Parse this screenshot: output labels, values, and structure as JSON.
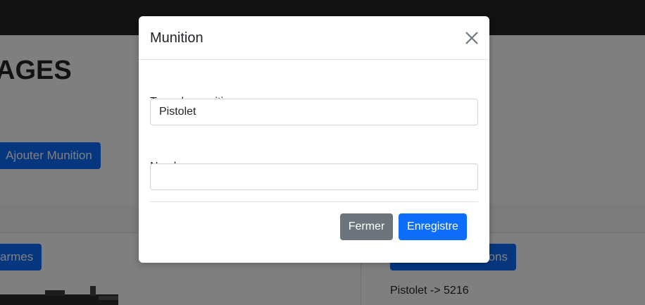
{
  "background": {
    "heading": "AGES",
    "add_ammo_button": "Ajouter Munition",
    "weapons_button": "armes",
    "ammo_list_button": "ons",
    "ammo_item": "Pistolet -> 5216"
  },
  "modal": {
    "title": "Munition",
    "close_icon": "close-icon",
    "type_label": "Type de munition",
    "type_value": "Pistolet",
    "count_label": "Nombre",
    "count_value": "",
    "close_button": "Fermer",
    "save_button": "Enregistre"
  },
  "colors": {
    "primary": "#0d6efd",
    "secondary": "#6c757d",
    "navbar": "#212529"
  }
}
